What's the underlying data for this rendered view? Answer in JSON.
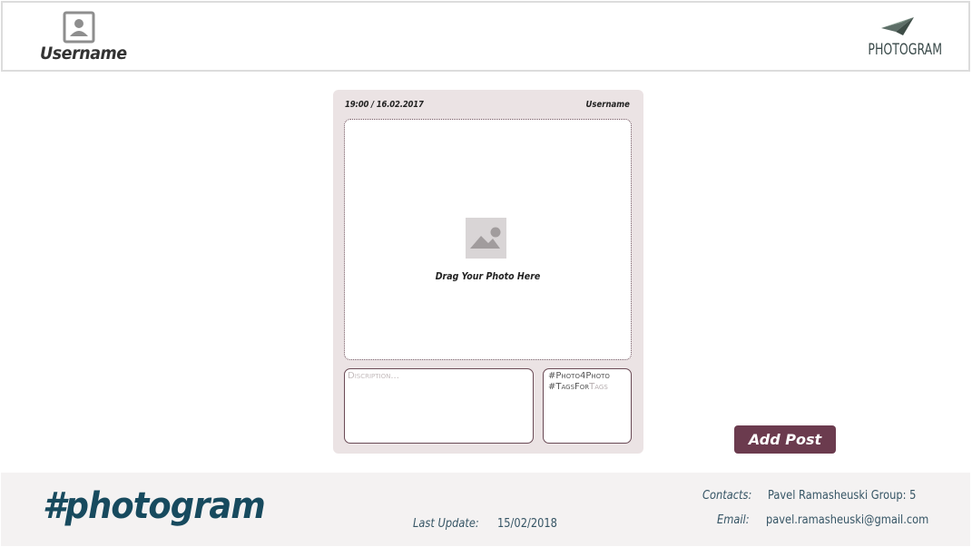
{
  "header": {
    "username": "Username",
    "avatar_icon": "user-avatar-icon",
    "logo_text": "PHOTOGRAM",
    "logo_icon": "paper-plane-icon"
  },
  "post_card": {
    "datetime": "19:00 / 16.02.2017",
    "username": "Username",
    "dropzone": {
      "icon": "image-placeholder-icon",
      "label": "Drag Your Photo Here"
    },
    "description": {
      "placeholder": "Discription..."
    },
    "tags": {
      "line1": "#Photo4Photo",
      "line2_prefix": "#TagsFor",
      "line2_suffix": "Tags"
    }
  },
  "actions": {
    "add_post_label": "Add Post"
  },
  "footer": {
    "brand": "#photogram",
    "last_update_label": "Last Update:",
    "last_update_value": "15/02/2018",
    "contacts_label": "Contacts:",
    "contacts_value": "Pavel Ramasheuski   Group: 5",
    "email_label": "Email:",
    "email_value": "pavel.ramasheuski@gmail.com"
  },
  "colors": {
    "card_bg": "#ebe3e4",
    "accent": "#6b3b4e",
    "brand": "#174a5e",
    "footer_bg": "#f4f2f2"
  }
}
